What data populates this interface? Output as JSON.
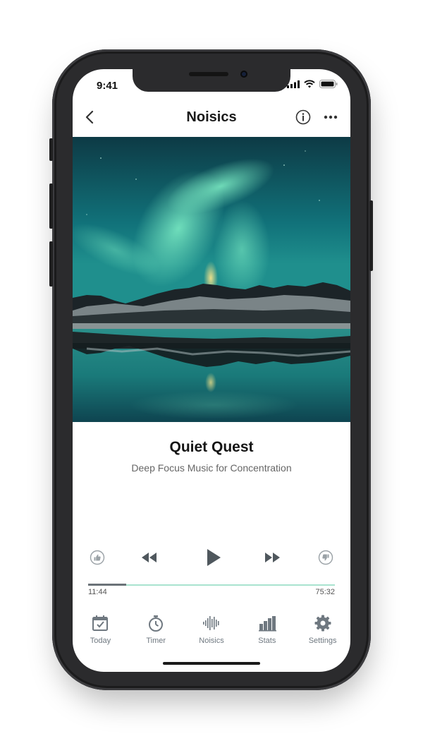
{
  "status_bar": {
    "time": "9:41"
  },
  "navbar": {
    "title": "Noisics"
  },
  "track": {
    "title": "Quiet Quest",
    "subtitle": "Deep Focus Music for Concentration"
  },
  "player": {
    "elapsed": "11:44",
    "total": "75:32",
    "progress": 0.155
  },
  "tabs": [
    {
      "label": "Today",
      "icon": "calendar-check-icon"
    },
    {
      "label": "Timer",
      "icon": "stopwatch-icon"
    },
    {
      "label": "Noisics",
      "icon": "waveform-icon"
    },
    {
      "label": "Stats",
      "icon": "bar-chart-icon"
    },
    {
      "label": "Settings",
      "icon": "gear-icon"
    }
  ],
  "colors": {
    "progress_accent": "#a9e3cf",
    "icon_gray": "#6f7880"
  }
}
